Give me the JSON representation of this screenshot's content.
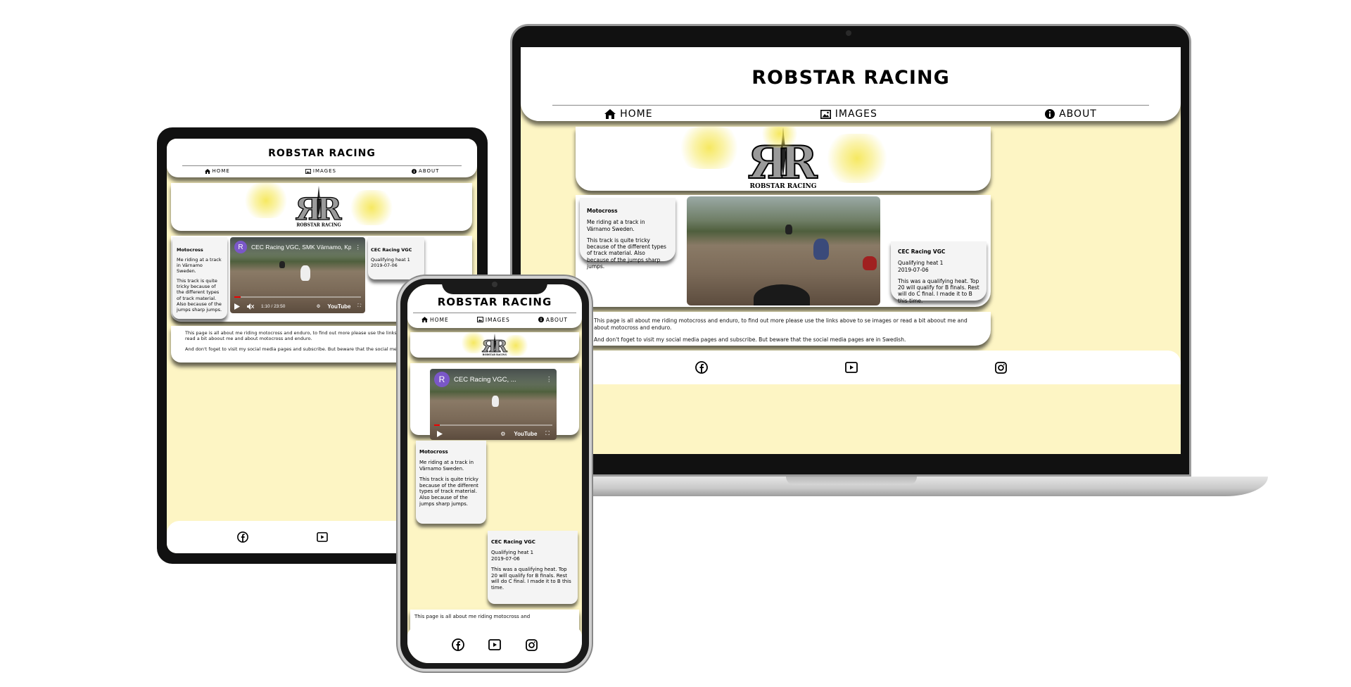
{
  "site": {
    "title": "ROBSTAR RACING",
    "nav": {
      "home": "HOME",
      "images": "IMAGES",
      "about": "ABOUT"
    },
    "logo_text": "ROBSTAR RACING",
    "motocross_card": {
      "title": "Motocross",
      "p1": "Me riding at a track in Värnamo Sweden.",
      "p2": "This track is quite tricky because of the different types of track material. Also because of the jumps sharp jumps."
    },
    "race_card": {
      "title": "CEC Racing VGC",
      "heat": "Qualifying heat 1",
      "date": "2019-07-06",
      "p": "This was a qualifying heat. Top 20 will qualify for B finals. Rest will do C final. I made it to B this time."
    },
    "intro": {
      "p1": "This page is all about me riding motocross and enduro, to find out more please use the links above to se images or read a bit aboout me and about motocross and enduro.",
      "p2": "And don't foget to visit my social media pages and subscribe. But beware that the social media pages are in Swedish.",
      "p1_tablet": "This page is all about me riding motocross and enduro, to find out more please use the links above to se images or read a bit aboout me and about motocross and enduro.",
      "phone_start": "This page is all about me riding motocross and"
    },
    "video": {
      "channel_initial": "R",
      "title_tablet": "CEC Racing VGC, SMK Värnamo, Kp...",
      "title_phone": "CEC Racing VGC, ...",
      "time": "1:10 / 23:50",
      "brand": "YouTube"
    },
    "footer_icons": [
      "facebook-icon",
      "youtube-icon",
      "instagram-icon"
    ]
  },
  "colors": {
    "page_bg": "#fdf5c4",
    "card_bg": "#ffffff",
    "text_card_bg": "#f4f4f4",
    "accent_yellow": "#f5e650",
    "yt_avatar": "#7a57c8"
  }
}
